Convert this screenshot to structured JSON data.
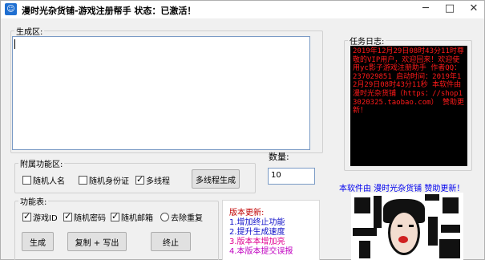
{
  "window": {
    "title": "漫时光杂货铺-游戏注册帮手  状态：已激活！",
    "icon": "chat-bubble-icon",
    "controls": {
      "minimize": "─",
      "maximize": "□",
      "close": "✕"
    }
  },
  "gen_group": {
    "legend": "生成区:"
  },
  "log_group": {
    "legend": "任务日志:",
    "text": "2019年12月29日08时43分11时尊敬的VIP用户，欢迎回来！欢迎使用yc影子游戏注册助手 作者QQ：237029851 启动时间：2019年12月29日08时43分11秒 本软件由 漫时光杂货铺（https：//shop13020325.taobao.com） 赞助更新！"
  },
  "aux_group": {
    "legend": "附属功能区:",
    "random_name": "随机人名",
    "random_id": "随机身份证",
    "multithread": "多线程",
    "multithread_generate": "多线程生成"
  },
  "quantity": {
    "label": "数量:",
    "value": "10"
  },
  "func_group": {
    "legend": "功能表:",
    "game_id": "游戏ID",
    "random_password": "随机密码",
    "random_email": "随机邮箱",
    "dedupe": "去除重复",
    "generate": "生成",
    "copy_write": "复制 + 写出",
    "stop": "终止"
  },
  "update": {
    "title": "版本更新:",
    "items": [
      {
        "text": "1.增加终止功能",
        "color": "#1010c8"
      },
      {
        "text": "2.提升生成速度",
        "color": "#1010c8"
      },
      {
        "text": "3.版本本增加亮",
        "color": "#e00090"
      },
      {
        "text": "4.本版本提交误报",
        "color": "#c000c0"
      }
    ]
  },
  "promo": "本软件由 漫时光杂货铺 赞助更新！"
}
